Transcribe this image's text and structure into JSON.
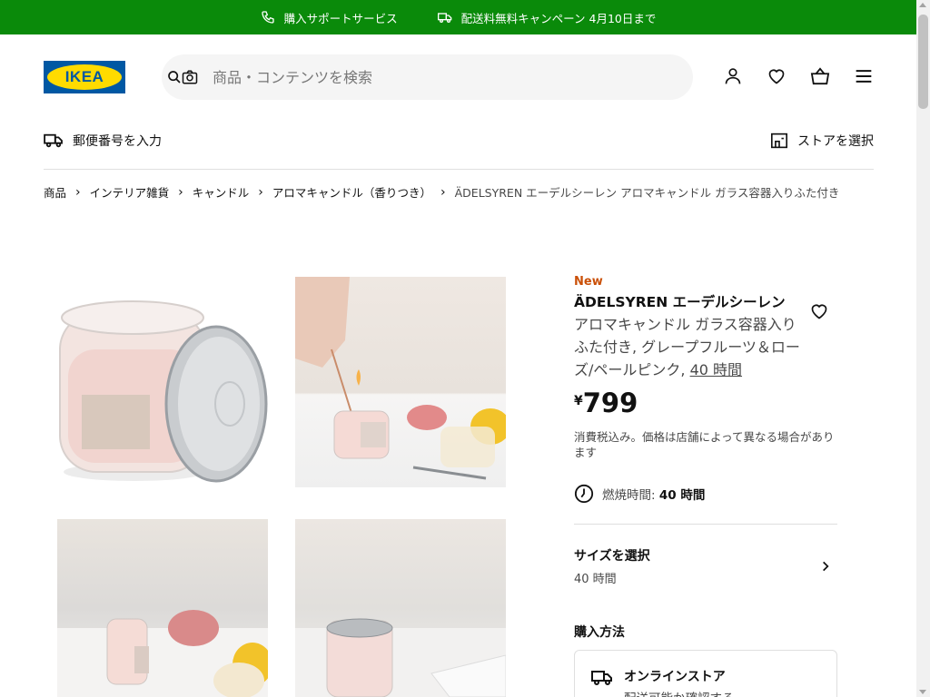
{
  "promo": {
    "support_label": "購入サポートサービス",
    "campaign_label": "配送料無料キャンペーン 4月10日まで"
  },
  "header": {
    "logo_text": "IKEA",
    "search_placeholder": "商品・コンテンツを検索"
  },
  "subnav": {
    "postal_label": "郵便番号を入力",
    "store_label": "ストアを選択"
  },
  "breadcrumb": {
    "items": [
      "商品",
      "インテリア雑貨",
      "キャンドル",
      "アロマキャンドル（香りつき）"
    ],
    "current": "ÄDELSYREN エーデルシーレン アロマキャンドル ガラス容器入りふた付き"
  },
  "product": {
    "badge": "New",
    "name": "ÄDELSYREN エーデルシーレン",
    "description": "アロマキャンドル ガラス容器入り ふた付き, グレープフルーツ＆ローズ/ペールピンク, ",
    "description_link": "40 時間",
    "currency": "¥",
    "price": "799",
    "tax_note": "消費税込み。価格は店舗によって異なる場合があります",
    "burn_label": "燃焼時間: ",
    "burn_value": "40 時間",
    "size_title": "サイズを選択",
    "size_value": "40 時間",
    "buy_title": "購入方法",
    "online_title": "オンラインストア",
    "online_link": "配送可能か確認する"
  },
  "colors": {
    "promo_green": "#0a8a0a",
    "new_orange": "#ca5008",
    "ikea_blue": "#0058a3",
    "ikea_yellow": "#ffdb00"
  }
}
